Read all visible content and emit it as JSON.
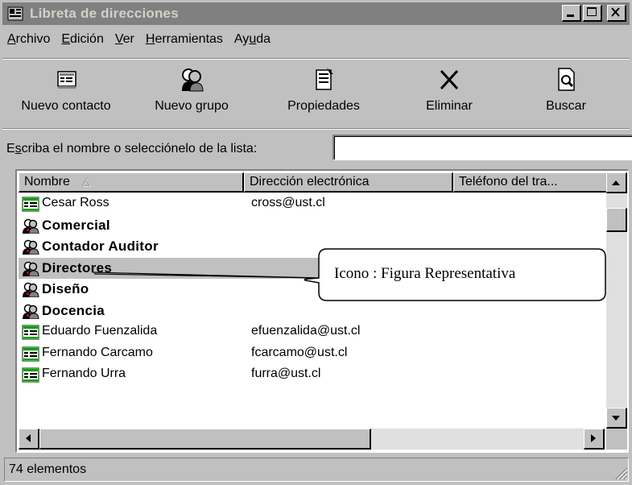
{
  "window": {
    "title": "Libreta de direcciones",
    "title_icon": "address-book-icon",
    "controls": [
      "minimize-icon",
      "maximize-icon",
      "close-icon"
    ]
  },
  "menu": {
    "items": [
      {
        "label_pre": "",
        "accel": "A",
        "label_post": "rchivo"
      },
      {
        "label_pre": "",
        "accel": "E",
        "label_post": "dición"
      },
      {
        "label_pre": "",
        "accel": "V",
        "label_post": "er"
      },
      {
        "label_pre": "",
        "accel": "H",
        "label_post": "erramientas"
      },
      {
        "label_pre": "Ay",
        "accel": "u",
        "label_post": "da"
      }
    ]
  },
  "toolbar": {
    "buttons": [
      {
        "label": "Nuevo contacto",
        "icon": "new-contact-icon"
      },
      {
        "label": "Nuevo grupo",
        "icon": "new-group-icon"
      },
      {
        "label": "Propiedades",
        "icon": "properties-icon"
      },
      {
        "label": "Eliminar",
        "icon": "delete-icon"
      },
      {
        "label": "Buscar",
        "icon": "find-icon"
      }
    ]
  },
  "search": {
    "label_pre": "E",
    "label_accel": "s",
    "label_post": "criba el nombre o selecciónelo de la lista:",
    "value": ""
  },
  "list": {
    "columns": [
      "Nombre",
      "Dirección electrónica",
      "Teléfono del tra..."
    ],
    "sort_indicator": "△",
    "rows": [
      {
        "name": "Cesar Ross",
        "email": "cross@ust.cl",
        "type": "contact"
      },
      {
        "name": "Comercial",
        "email": "",
        "type": "group"
      },
      {
        "name": "Contador Auditor",
        "email": "",
        "type": "group"
      },
      {
        "name": "Directores",
        "email": "",
        "type": "group"
      },
      {
        "name": "Diseño",
        "email": "",
        "type": "group"
      },
      {
        "name": "Docencia",
        "email": "",
        "type": "group"
      },
      {
        "name": "Eduardo Fuenzalida",
        "email": "efuenzalida@ust.cl",
        "type": "contact"
      },
      {
        "name": "Fernando Carcamo",
        "email": "fcarcamo@ust.cl",
        "type": "contact"
      },
      {
        "name": "Fernando Urra",
        "email": "furra@ust.cl",
        "type": "contact"
      }
    ]
  },
  "callout": {
    "text": "Icono : Figura Representativa"
  },
  "status": {
    "text": "74 elementos"
  }
}
